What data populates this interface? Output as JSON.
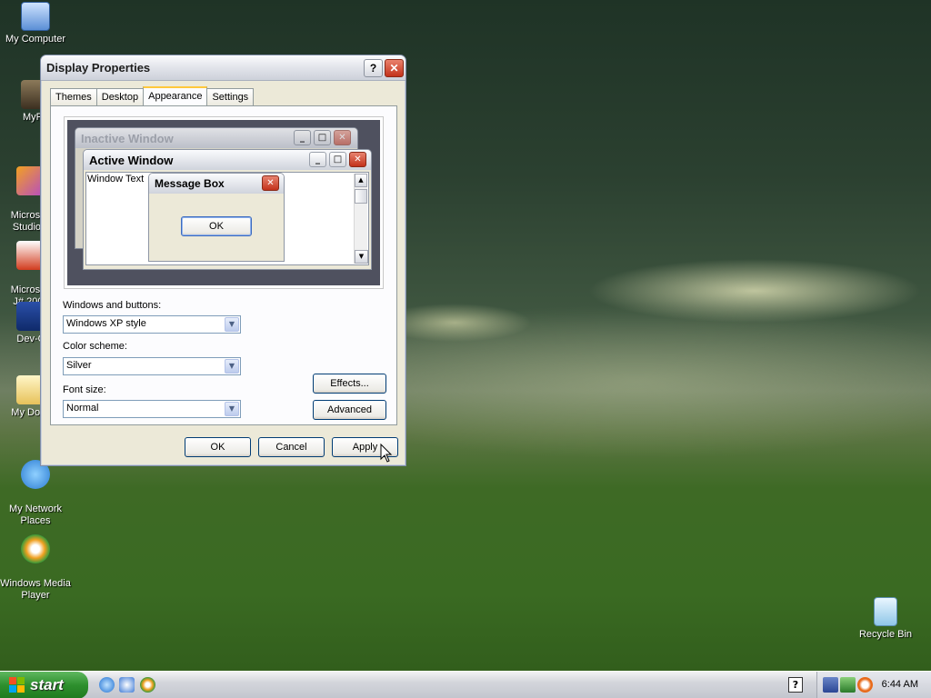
{
  "desktop": {
    "icons": [
      {
        "label": "My Computer"
      },
      {
        "label": "MyPa"
      },
      {
        "label": "Microsoft\nStudio 2"
      },
      {
        "label": "Microsoft\nJ# 2005"
      },
      {
        "label": "Dev-C"
      },
      {
        "label": "My Docu"
      },
      {
        "label": "My Network\nPlaces"
      },
      {
        "label": "Windows Media\nPlayer"
      },
      {
        "label": "Recycle Bin"
      }
    ]
  },
  "dialog": {
    "title": "Display Properties",
    "help_glyph": "?",
    "close_glyph": "✕",
    "tabs": [
      {
        "label": "Themes",
        "active": false
      },
      {
        "label": "Desktop",
        "active": false
      },
      {
        "label": "Appearance",
        "active": true
      },
      {
        "label": "Settings",
        "active": false
      }
    ],
    "preview": {
      "inactive_title": "Inactive Window",
      "active_title": "Active Window",
      "window_text": "Window Text",
      "message_box_title": "Message Box",
      "message_box_ok": "OK"
    },
    "windows_and_buttons": {
      "label": "Windows and buttons:",
      "value": "Windows XP style"
    },
    "color_scheme": {
      "label": "Color scheme:",
      "value": "Silver"
    },
    "font_size": {
      "label": "Font size:",
      "value": "Normal"
    },
    "effects_button": "Effects...",
    "advanced_button": "Advanced",
    "ok_button": "OK",
    "cancel_button": "Cancel",
    "apply_button": "Apply"
  },
  "taskbar": {
    "start_label": "start",
    "clock": "6:44 AM",
    "help_glyph": "?"
  }
}
